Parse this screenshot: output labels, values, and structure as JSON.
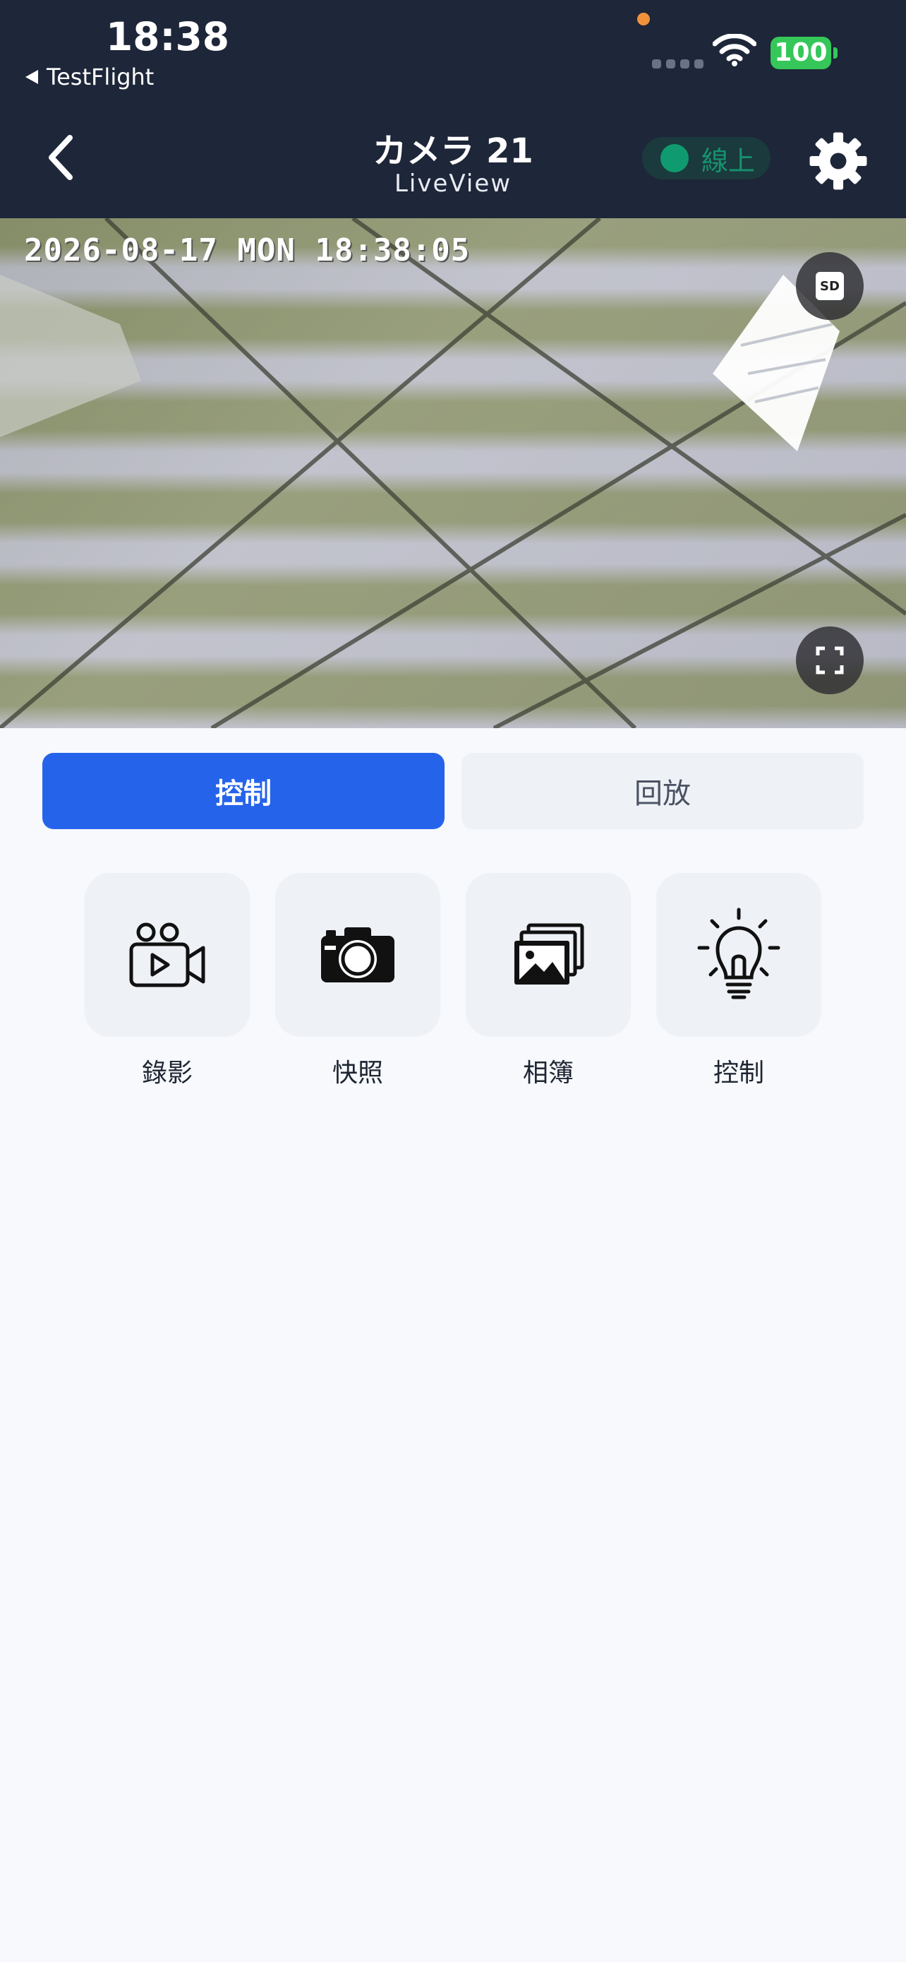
{
  "status_bar": {
    "time": "18:38",
    "back_app": "TestFlight",
    "battery": "100"
  },
  "nav": {
    "title": "カメラ 21",
    "subtitle": "LiveView",
    "status": "線上"
  },
  "video": {
    "timestamp": "2026-08-17 MON 18:38:05",
    "quality_badge": "SD"
  },
  "tabs": [
    {
      "label": "控制",
      "active": true
    },
    {
      "label": "回放",
      "active": false
    }
  ],
  "actions": [
    {
      "label": "錄影",
      "icon": "video-camera-icon"
    },
    {
      "label": "快照",
      "icon": "camera-icon"
    },
    {
      "label": "相簿",
      "icon": "gallery-icon"
    },
    {
      "label": "控制",
      "icon": "lightbulb-icon"
    }
  ],
  "colors": {
    "header_bg": "#1e2639",
    "accent": "#2563eb",
    "online": "#0f9b6f",
    "battery": "#35c759"
  }
}
